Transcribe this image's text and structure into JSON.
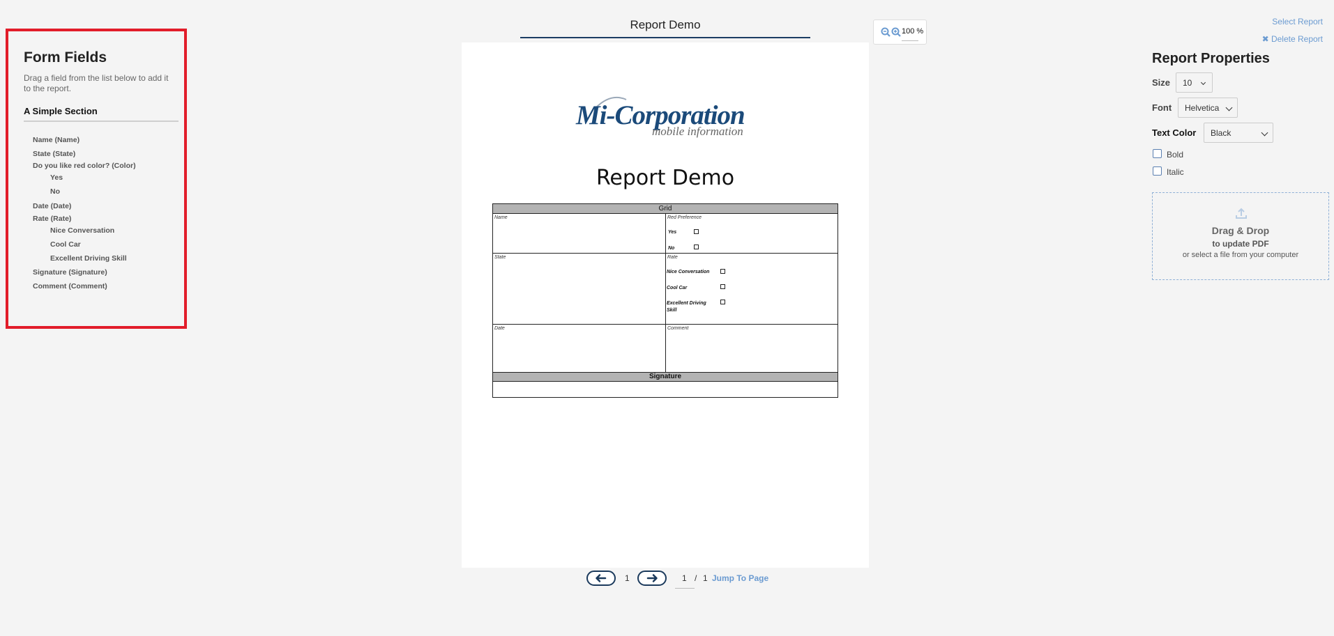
{
  "left_panel": {
    "title": "Form Fields",
    "subtitle": "Drag a field from the list below to add it to the report.",
    "section_title": "A Simple Section",
    "fields": {
      "name": "Name (Name)",
      "state": "State (State)",
      "color": "Do you like red color? (Color)",
      "color_yes": "Yes",
      "color_no": "No",
      "date": "Date (Date)",
      "rate": "Rate (Rate)",
      "rate_nice": "Nice Conversation",
      "rate_car": "Cool Car",
      "rate_driving": "Excellent Driving Skill",
      "signature": "Signature (Signature)",
      "comment": "Comment (Comment)"
    }
  },
  "header": {
    "doc_title": "Report Demo",
    "zoom": "100 %"
  },
  "page": {
    "logo_main": "Mi-Corporation",
    "logo_sub": "mobile information",
    "heading": "Report Demo",
    "grid": {
      "header": "Grid",
      "name_label": "Name",
      "red_pref_label": "Red Preference",
      "yes": "Yes",
      "no": "No",
      "state_label": "State",
      "rate_label": "Rate",
      "nice": "Nice Conversation",
      "car": "Cool Car",
      "driving_1": "Excellent Driving",
      "driving_2": "Skill",
      "date_label": "Date",
      "comment_label": "Comment",
      "signature_header": "Signature"
    }
  },
  "pagination": {
    "current": "1",
    "jump_value": "1",
    "separator": "/",
    "total": "1",
    "jump_label": "Jump To Page"
  },
  "right_panel": {
    "select_report": "Select Report",
    "delete_report": "✖ Delete Report",
    "title": "Report Properties",
    "size_label": "Size",
    "size_value": "10",
    "font_label": "Font",
    "font_value": "Helvetica",
    "color_label": "Text Color",
    "color_value": "Black",
    "bold_label": "Bold",
    "italic_label": "Italic",
    "dropzone": {
      "title": "Drag & Drop",
      "sub1": "to update PDF",
      "sub2": "or select a file from your computer"
    }
  },
  "colors": {
    "highlight_border": "#e21d2a",
    "link": "#6b9bd1",
    "nav_dark": "#1b3a5c"
  }
}
